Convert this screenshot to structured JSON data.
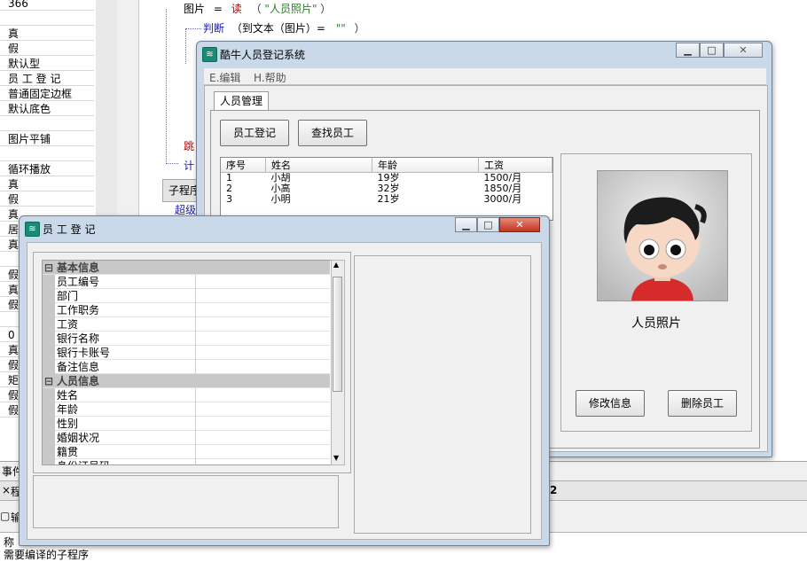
{
  "left_panel": {
    "rows": [
      "366",
      "",
      "真",
      "假",
      "默认型",
      "员 工 登 记",
      "普通固定边框",
      "默认底色",
      "",
      "图片平铺",
      "",
      "循环播放",
      "真",
      "假",
      "真",
      "居",
      "真",
      "",
      "假",
      "真",
      "假",
      "",
      "0",
      "真",
      "假",
      "矩",
      "假",
      "假"
    ]
  },
  "code": {
    "line1_var": "图片",
    "line1_op": "=",
    "line1_fn": "读",
    "line1_open": "（",
    "line1_arg": "\"人员照片\"",
    "line1_close": "）",
    "line2_kw": "判断",
    "line2_expr": "（到文本（图片）=",
    "line2_str": "\"\"",
    "line2_close": "）",
    "line3": "跳",
    "line4": "计",
    "fragment_tab": "子程序",
    "fragment_link": "超级"
  },
  "bottom": {
    "tab1": "事件",
    "tab2": "程",
    "tab_num": "2",
    "row3": "输",
    "row4a": "称",
    "row4b": "需要编译的子程序"
  },
  "main_window": {
    "title": "酷牛人员登记系统",
    "menu": [
      "E.编辑",
      "H.帮助"
    ],
    "tab": "人员管理",
    "btn_register": "员工登记",
    "btn_search": "查找员工",
    "table": {
      "headers": [
        "序号",
        "姓名",
        "年龄",
        "工资"
      ],
      "rows": [
        [
          "1",
          "小胡",
          "19岁",
          "1500/月"
        ],
        [
          "2",
          "小高",
          "32岁",
          "1850/月"
        ],
        [
          "3",
          "小明",
          "21岁",
          "3000/月"
        ]
      ]
    },
    "photo_label": "人员照片",
    "btn_edit": "修改信息",
    "btn_delete": "删除员工"
  },
  "reg_window": {
    "title": "员 工 登 记",
    "categories": [
      {
        "name": "基本信息",
        "items": [
          "员工编号",
          "部门",
          "工作职务",
          "工资",
          "银行名称",
          "银行卡账号",
          "备注信息"
        ]
      },
      {
        "name": "人员信息",
        "items": [
          "姓名",
          "年龄",
          "性别",
          "婚姻状况",
          "籍贯",
          "身份证号码"
        ]
      }
    ],
    "collapse_glyph": "⊟"
  }
}
